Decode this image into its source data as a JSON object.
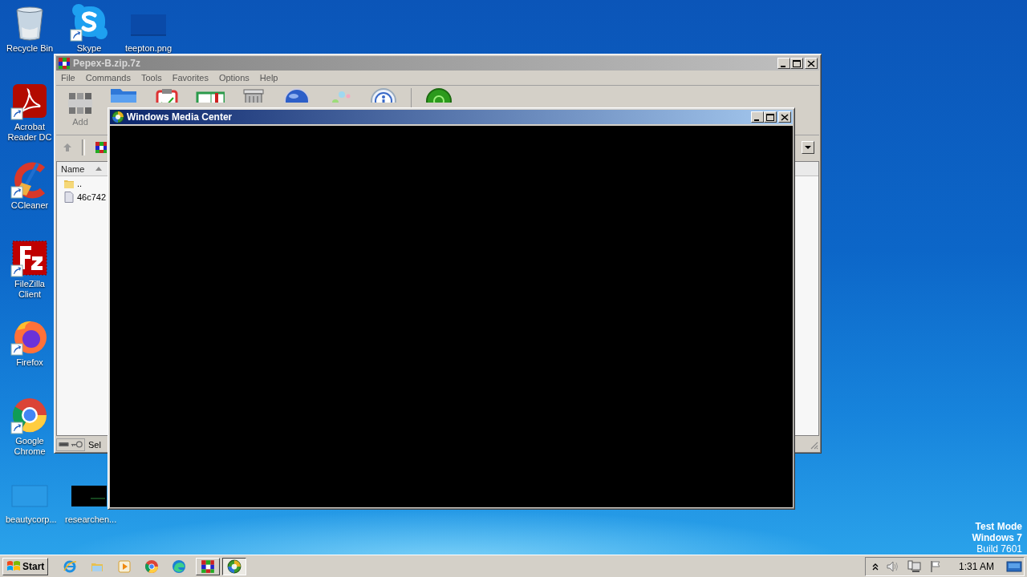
{
  "desktop": {
    "icons": [
      {
        "label": "Recycle Bin",
        "kind": "recycle",
        "shortcut": false
      },
      {
        "label": "Skype",
        "kind": "skype",
        "shortcut": true
      },
      {
        "label": "teepton.png",
        "kind": "image-dark",
        "shortcut": false
      },
      {
        "label": "Acrobat Reader DC",
        "kind": "acrobat",
        "shortcut": true
      },
      {
        "label": "CCleaner",
        "kind": "ccleaner",
        "shortcut": true
      },
      {
        "label": "FileZilla Client",
        "kind": "filezilla",
        "shortcut": true
      },
      {
        "label": "Firefox",
        "kind": "firefox",
        "shortcut": true
      },
      {
        "label": "Google Chrome",
        "kind": "chrome",
        "shortcut": true
      },
      {
        "label": "beautycorp...",
        "kind": "image-blue",
        "shortcut": false
      },
      {
        "label": "researchen...",
        "kind": "image-black",
        "shortcut": false
      }
    ],
    "system_text": {
      "test_mode": "Test Mode",
      "os": "Windows 7",
      "build": "Build 7601"
    }
  },
  "windows": [
    {
      "kind": "archiver",
      "title": "Pepex-B.zip.7z",
      "active": false,
      "menu": [
        "File",
        "Commands",
        "Tools",
        "Favorites",
        "Options",
        "Help"
      ],
      "toolbar": [
        {
          "kind": "add",
          "label": "Add"
        },
        {
          "kind": "extract"
        },
        {
          "kind": "test"
        },
        {
          "kind": "view"
        },
        {
          "kind": "delete"
        },
        {
          "kind": "find"
        },
        {
          "kind": "wizard"
        },
        {
          "kind": "info"
        },
        {
          "kind": "virus"
        }
      ],
      "list": {
        "columns": [
          "Name"
        ],
        "rows": [
          {
            "kind": "folder",
            "name": ".."
          },
          {
            "kind": "file",
            "name": "46c742"
          }
        ]
      },
      "status": "Sel"
    },
    {
      "kind": "media",
      "title": "Windows Media Center",
      "active": true
    }
  ],
  "taskbar": {
    "start": "Start",
    "quick_launch": [
      {
        "kind": "ie"
      },
      {
        "kind": "explorer"
      },
      {
        "kind": "player"
      },
      {
        "kind": "chrome"
      },
      {
        "kind": "edge"
      }
    ],
    "tasks": [
      {
        "kind": "archiver",
        "selected": false
      },
      {
        "kind": "media",
        "selected": true
      }
    ],
    "clock": "1:31 AM"
  }
}
